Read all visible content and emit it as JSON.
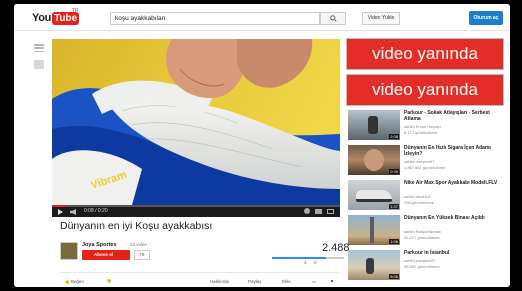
{
  "header": {
    "logo_you": "You",
    "logo_tube": "Tube",
    "logo_region": "TR",
    "search_value": "koşu ayakkabıları",
    "upload_label": "Video Yükle",
    "signin_label": "Oturum aç"
  },
  "player": {
    "time": "0:08 / 0:20",
    "progress": 0.05
  },
  "video": {
    "title": "Dünyanın en iyi Koşu ayakkabısı",
    "channel_name": "Joya Sportes",
    "channel_videos": "22 video",
    "subscribe_label": "Abone ol",
    "subscriber_count": "78",
    "views": "2.488",
    "like_ratio": 0.75,
    "likes": "3",
    "dislikes": "0"
  },
  "actions": {
    "like_label": "Beğen",
    "about_label": "Hakkında",
    "share_label": "Paylaş",
    "add_label": "Ekle"
  },
  "ads": [
    {
      "text": "video yanında"
    },
    {
      "text": "video yanında"
    }
  ],
  "recommendations": [
    {
      "title": "Parkour - Sokak Atlayışları - Serbest Atlama",
      "by": "sahibi Ercan Hoşcan",
      "views": "6.172 görüntüleme",
      "duration": "2:08"
    },
    {
      "title": "Dünyanın En Hızlı Sigara İçen Adamı İzleyin?",
      "by": "sahibi meryem97",
      "views": "1.887.661 görüntüleme",
      "duration": "0:39"
    },
    {
      "title": "Nike Air Max Spor Ayakkabı Modeli.FLV",
      "by": "sahibi abcd101",
      "views": "708 görüntüleme",
      "duration": "1:37"
    },
    {
      "title": "Dünyanın En Yüksek Binası Açıldı",
      "by": "sahibi RadyoHandan",
      "views": "42.017 görüntüleme",
      "duration": "1:06"
    },
    {
      "title": "Parkour in İstanbul",
      "by": "sahibi joshparb22",
      "views": "26.587 görüntüleme",
      "duration": "5:06"
    }
  ]
}
